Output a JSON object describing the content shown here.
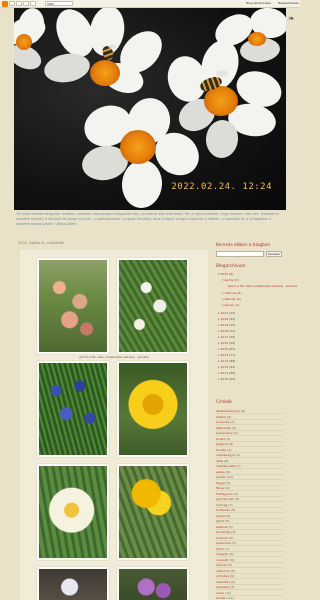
{
  "navbar": {
    "more_label": "Több",
    "create_label": "Blog létrehozása",
    "signin_label": "Bejelentkezés"
  },
  "header": {
    "timestamp": "2022.02.24. 12:24"
  },
  "description": "\"Ez által lehetsz bárgyúan rendben, szelíden mosolyogva hallgatnál róla, ha semmi sem szerinted. Tán a nyárra várnék, hogy minden, ami van, lehessen a szeretet helyett, a kinyílott és sárga kinyúló... a pálmalevelek nyugodt fénylése, ahol virágról virágra repülnek a méhek, a napsütés és a virágokban a szeretet meleg szívek.\" Wass Albert",
  "post": {
    "date": "2022. április 8., csütörtök",
    "caption": "Jácint a fán után (vadbirsben karsza) - piroska"
  },
  "sidebar": {
    "search_title": "Keresés ebben a blogban",
    "search_button": "Keresés",
    "archive_title": "Blogarchívum",
    "archive": [
      {
        "label": "2022",
        "count": "(8)"
      },
      {
        "label": "április",
        "count": "(1)"
      },
      {
        "label": "Jácint a fán után (vadbirsben karsza) - piroska",
        "count": ""
      },
      {
        "label": "március",
        "count": "(4)"
      },
      {
        "label": "február",
        "count": "(2)"
      },
      {
        "label": "január",
        "count": "(1)"
      },
      {
        "label": "2021",
        "count": "(29)"
      },
      {
        "label": "2020",
        "count": "(42)"
      },
      {
        "label": "2019",
        "count": "(45)"
      },
      {
        "label": "2018",
        "count": "(52)"
      },
      {
        "label": "2017",
        "count": "(49)"
      },
      {
        "label": "2016",
        "count": "(58)"
      },
      {
        "label": "2015",
        "count": "(63)"
      },
      {
        "label": "2014",
        "count": "(71)"
      },
      {
        "label": "2013",
        "count": "(88)"
      },
      {
        "label": "2012",
        "count": "(94)"
      },
      {
        "label": "2011",
        "count": "(86)"
      },
      {
        "label": "2010",
        "count": "(65)"
      }
    ],
    "labels_title": "Címkék",
    "labels": [
      {
        "label": "ablakpárkányon",
        "count": "(6)"
      },
      {
        "label": "állatok",
        "count": "(6)"
      },
      {
        "label": "árvácska",
        "count": "(7)"
      },
      {
        "label": "áttekintés",
        "count": "(2)"
      },
      {
        "label": "bazsarózsa",
        "count": "(5)"
      },
      {
        "label": "bodza",
        "count": "(3)"
      },
      {
        "label": "begónia",
        "count": "(8)"
      },
      {
        "label": "boróka",
        "count": "(2)"
      },
      {
        "label": "csipkebogyó",
        "count": "(4)"
      },
      {
        "label": "dália",
        "count": "(6)"
      },
      {
        "label": "díszkáposzta",
        "count": "(5)"
      },
      {
        "label": "estike",
        "count": "(4)"
      },
      {
        "label": "évelők",
        "count": "(12)"
      },
      {
        "label": "fagyal",
        "count": "(3)"
      },
      {
        "label": "fikusz",
        "count": "(4)"
      },
      {
        "label": "fokhagyma",
        "count": "(5)"
      },
      {
        "label": "gyümölcsök",
        "count": "(9)"
      },
      {
        "label": "hóvirág",
        "count": "(7)"
      },
      {
        "label": "hortenzia",
        "count": "(8)"
      },
      {
        "label": "ibolya",
        "count": "(6)"
      },
      {
        "label": "jácint",
        "count": "(5)"
      },
      {
        "label": "kaktusz",
        "count": "(3)"
      },
      {
        "label": "kardvirág",
        "count": "(4)"
      },
      {
        "label": "krókusz",
        "count": "(6)"
      },
      {
        "label": "levendula",
        "count": "(5)"
      },
      {
        "label": "liliom",
        "count": "(7)"
      },
      {
        "label": "magvak",
        "count": "(4)"
      },
      {
        "label": "muskátli",
        "count": "(9)"
      },
      {
        "label": "nárcisz",
        "count": "(8)"
      },
      {
        "label": "nőszirom",
        "count": "(5)"
      },
      {
        "label": "orchidea",
        "count": "(6)"
      },
      {
        "label": "őszirózsa",
        "count": "(3)"
      },
      {
        "label": "pitypang",
        "count": "(2)"
      },
      {
        "label": "rózsa",
        "count": "(11)"
      },
      {
        "label": "tulipán",
        "count": "(10)"
      }
    ]
  }
}
